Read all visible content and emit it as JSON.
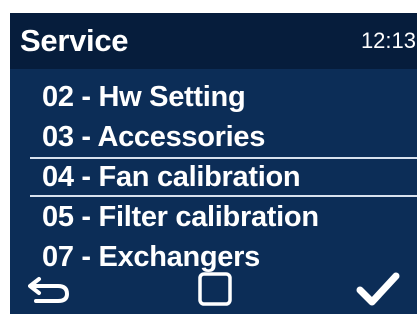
{
  "header": {
    "title": "Service",
    "time": "12:13"
  },
  "menu": {
    "items": [
      {
        "label": "02 - Hw Setting",
        "selected": false
      },
      {
        "label": "03 - Accessories",
        "selected": false
      },
      {
        "label": "04 - Fan calibration",
        "selected": true
      },
      {
        "label": "05 - Filter calibration",
        "selected": false
      },
      {
        "label": "07 - Exchangers",
        "selected": false
      }
    ]
  },
  "footer": {
    "left_icon": "back-arrow-icon",
    "center_icon": "square-icon",
    "right_icon": "checkmark-icon"
  },
  "colors": {
    "screen_background": "#0c2d57",
    "header_background": "#061d3c",
    "text": "#ffffff",
    "selection_line": "#d7e1ee"
  }
}
